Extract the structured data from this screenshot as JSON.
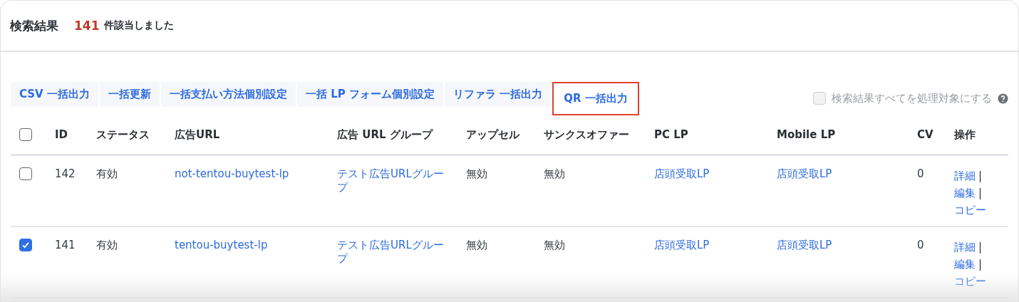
{
  "header": {
    "title": "検索結果",
    "count": "141",
    "count_suffix": "件該当しました"
  },
  "toolbar": {
    "buttons": [
      {
        "label": "CSV 一括出力",
        "highlighted": false
      },
      {
        "label": "一括更新",
        "highlighted": false
      },
      {
        "label": "一括支払い方法個別設定",
        "highlighted": false
      },
      {
        "label": "一括 LP フォーム個別設定",
        "highlighted": false
      },
      {
        "label": "リファラ 一括出力",
        "highlighted": false
      },
      {
        "label": "QR 一括出力",
        "highlighted": true
      }
    ],
    "select_all_results": {
      "label": "検索結果すべてを処理対象にする",
      "checked": false,
      "disabled": true
    }
  },
  "table": {
    "select_all_checked": false,
    "columns": [
      "ID",
      "ステータス",
      "広告URL",
      "広告 URL グループ",
      "アップセル",
      "サンクスオファー",
      "PC LP",
      "Mobile LP",
      "CV",
      "操作"
    ],
    "rows": [
      {
        "checked": false,
        "id": "142",
        "status": "有効",
        "ad_url": "not-tentou-buytest-lp",
        "url_group": "テスト広告URLグループ",
        "upsell": "無効",
        "thanks_offer": "無効",
        "pc_lp": "店頭受取LP",
        "mobile_lp": "店頭受取LP",
        "cv": "0",
        "actions": [
          {
            "label": "詳細",
            "separator": "|"
          },
          {
            "label": "編集",
            "separator": "|"
          },
          {
            "label": "コピー"
          }
        ]
      },
      {
        "checked": true,
        "id": "141",
        "status": "有効",
        "ad_url": "tentou-buytest-lp",
        "url_group": "テスト広告URLグループ",
        "upsell": "無効",
        "thanks_offer": "無効",
        "pc_lp": "店頭受取LP",
        "mobile_lp": "店頭受取LP",
        "cv": "0",
        "actions": [
          {
            "label": "詳細",
            "separator": "|"
          },
          {
            "label": "編集",
            "separator": "|"
          },
          {
            "label": "コピー"
          }
        ]
      }
    ]
  }
}
